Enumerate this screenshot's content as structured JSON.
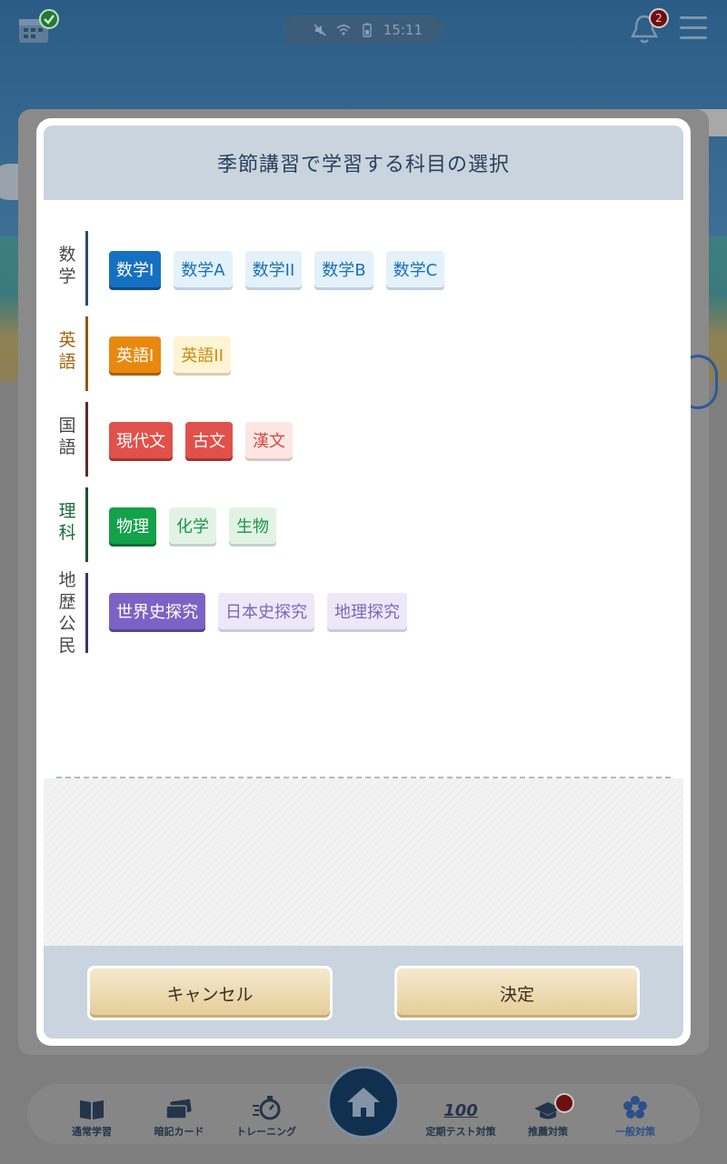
{
  "status_bar": {
    "time": "15:11"
  },
  "notifications": {
    "badge_count": "2"
  },
  "modal": {
    "title": "季節講習で学習する科目の選択",
    "subjects": [
      {
        "label": "数学",
        "options": [
          "数学I",
          "数学A",
          "数学II",
          "数学B",
          "数学C"
        ],
        "selected": "数学I"
      },
      {
        "label": "英語",
        "options": [
          "英語I",
          "英語II"
        ],
        "selected": "英語I"
      },
      {
        "label": "国語",
        "options": [
          "現代文",
          "古文",
          "漢文"
        ],
        "selected": [
          "現代文",
          "古文"
        ]
      },
      {
        "label": "理科",
        "options": [
          "物理",
          "化学",
          "生物"
        ],
        "selected": "物理"
      },
      {
        "label": "地歴公民",
        "options": [
          "世界史探究",
          "日本史探究",
          "地理探究"
        ],
        "selected": "世界史探究"
      }
    ],
    "cancel_label": "キャンセル",
    "confirm_label": "決定"
  },
  "bottom_nav": {
    "items": [
      "通常学習",
      "暗記カード",
      "トレーニング",
      "定期テスト対策",
      "推薦対策",
      "一般対策"
    ],
    "icon_text_100": "100"
  },
  "colors": {
    "math": "#1570c1",
    "english": "#e8890e",
    "japanese": "#e1514b",
    "science": "#13a14a",
    "social": "#7d62c5",
    "header": "#cad4de"
  }
}
